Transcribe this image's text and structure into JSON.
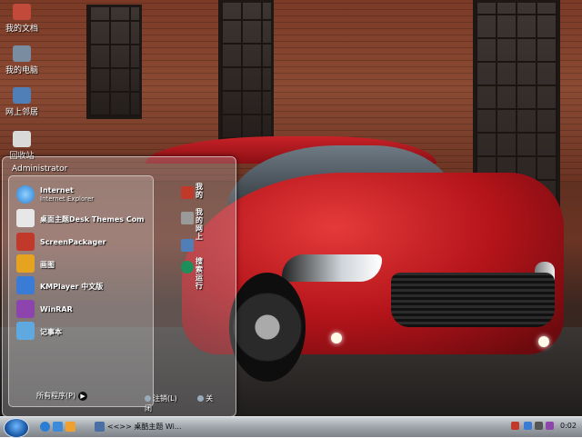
{
  "desktop": {
    "icons": [
      {
        "label": "我的文档",
        "icon": "my-documents-icon",
        "color": "#c24a3a"
      },
      {
        "label": "我的电脑",
        "icon": "my-computer-icon",
        "color": "#7a8da0"
      },
      {
        "label": "网上邻居",
        "icon": "network-places-icon",
        "color": "#4f7fb6"
      },
      {
        "label": "回收站",
        "icon": "recycle-bin-icon",
        "color": "#d9d9d9"
      }
    ]
  },
  "start_menu": {
    "user": "Administrator",
    "programs": [
      {
        "name": "Internet",
        "sub": "Internet Explorer",
        "icon": "internet-explorer-icon",
        "color": "#2a7fd4"
      },
      {
        "name": "桌面主题Desk Themes Com",
        "sub": "",
        "icon": "desk-themes-icon",
        "color": "#e7e7e7"
      },
      {
        "name": "ScreenPackager",
        "sub": "",
        "icon": "screenpackager-icon",
        "color": "#c0392b"
      },
      {
        "name": "画图",
        "sub": "",
        "icon": "paint-icon",
        "color": "#e6a320"
      },
      {
        "name": "KMPlayer 中文版",
        "sub": "",
        "icon": "kmplayer-icon",
        "color": "#3a7bd5"
      },
      {
        "name": "WinRAR",
        "sub": "",
        "icon": "winrar-icon",
        "color": "#8e44ad"
      },
      {
        "name": "记事本",
        "sub": "",
        "icon": "notepad-icon",
        "color": "#5fa8e0"
      }
    ],
    "all_programs": "所有程序(P)",
    "right_items": [
      {
        "label": "我的",
        "icon": "documents-folder-icon",
        "color": "#c0392b"
      },
      {
        "label": "我的网上",
        "icon": "network-icon",
        "color": "#9a9a9a"
      },
      {
        "label": "",
        "icon": "help-icon",
        "color": "#4f7fb6"
      },
      {
        "label": "搜索运行",
        "icon": "search-icon",
        "color": "#1c8f5a"
      }
    ],
    "logoff": "注销(L)",
    "shutdown": "关闭"
  },
  "taskbar": {
    "window_text": "<<>> 桌酷主题   Wi...",
    "clock": "0:02"
  }
}
